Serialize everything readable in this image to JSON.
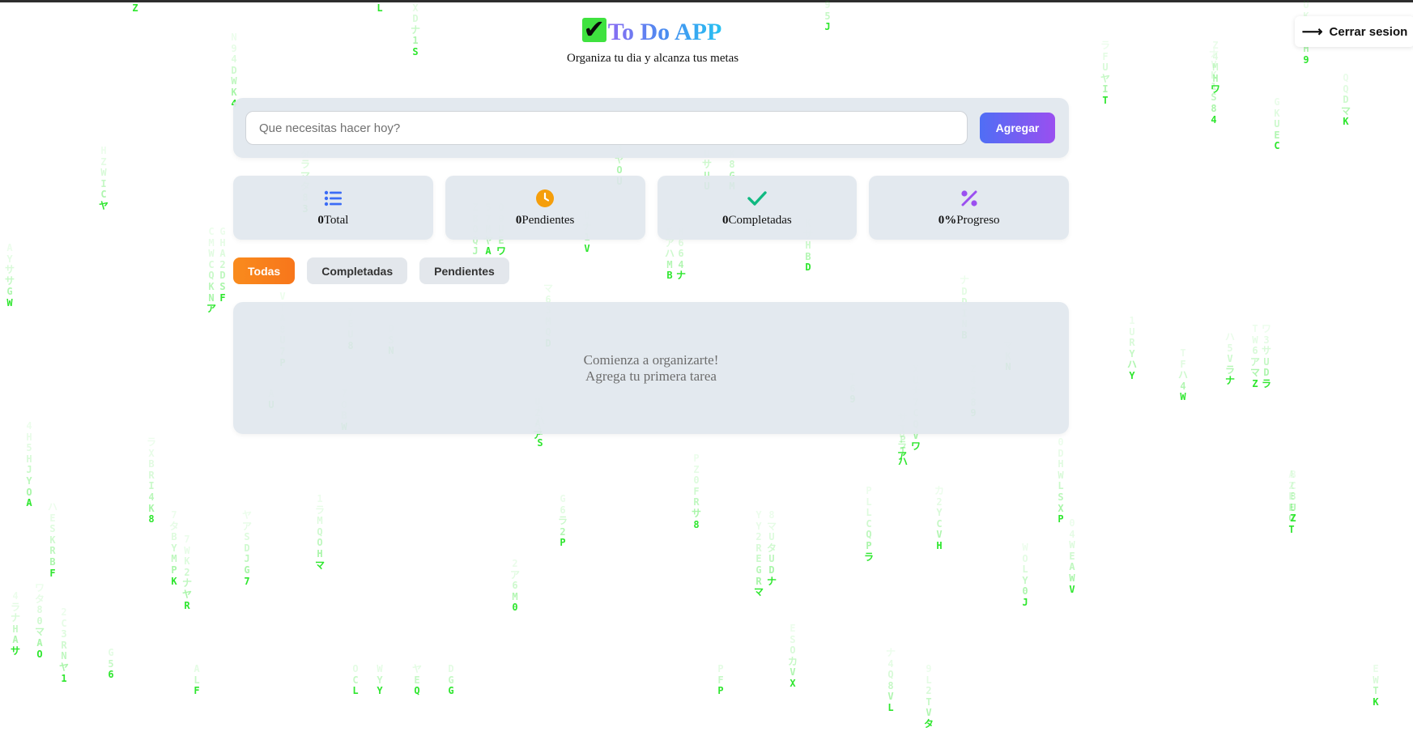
{
  "header": {
    "title": "To Do APP",
    "subtitle": "Organiza tu dia y alcanza tus metas"
  },
  "logout": {
    "label": "Cerrar sesion"
  },
  "task_input": {
    "placeholder": "Que necesitas hacer hoy?"
  },
  "add_button": {
    "label": "Agregar"
  },
  "stats": {
    "total": {
      "value": "0",
      "label": "Total"
    },
    "pending": {
      "value": "0",
      "label": "Pendientes"
    },
    "completed": {
      "value": "0",
      "label": "Completadas"
    },
    "progress": {
      "value": "0%",
      "label": "Progreso"
    }
  },
  "filters": {
    "all": "Todas",
    "completed": "Completadas",
    "pending": "Pendientes",
    "active": "all"
  },
  "empty_state": {
    "line1": "Comienza a organizarte!",
    "line2": "Agrega tu primera tarea"
  },
  "colors": {
    "accent_orange": "#f98b1d",
    "button_gradient_start": "#4f6ef5",
    "button_gradient_end": "#9a4ff0",
    "matrix_green": "#2ee62e",
    "total_icon": "#3b6cf6",
    "pending_icon": "#f59e0b",
    "completed_icon": "#10b981",
    "progress_icon": "#9b4ff0"
  },
  "icons": {
    "logo": "check-mark-icon",
    "logout": "arrow-right-icon",
    "total": "list-icon",
    "pending": "clock-icon",
    "completed": "check-icon",
    "progress": "percent-icon"
  }
}
